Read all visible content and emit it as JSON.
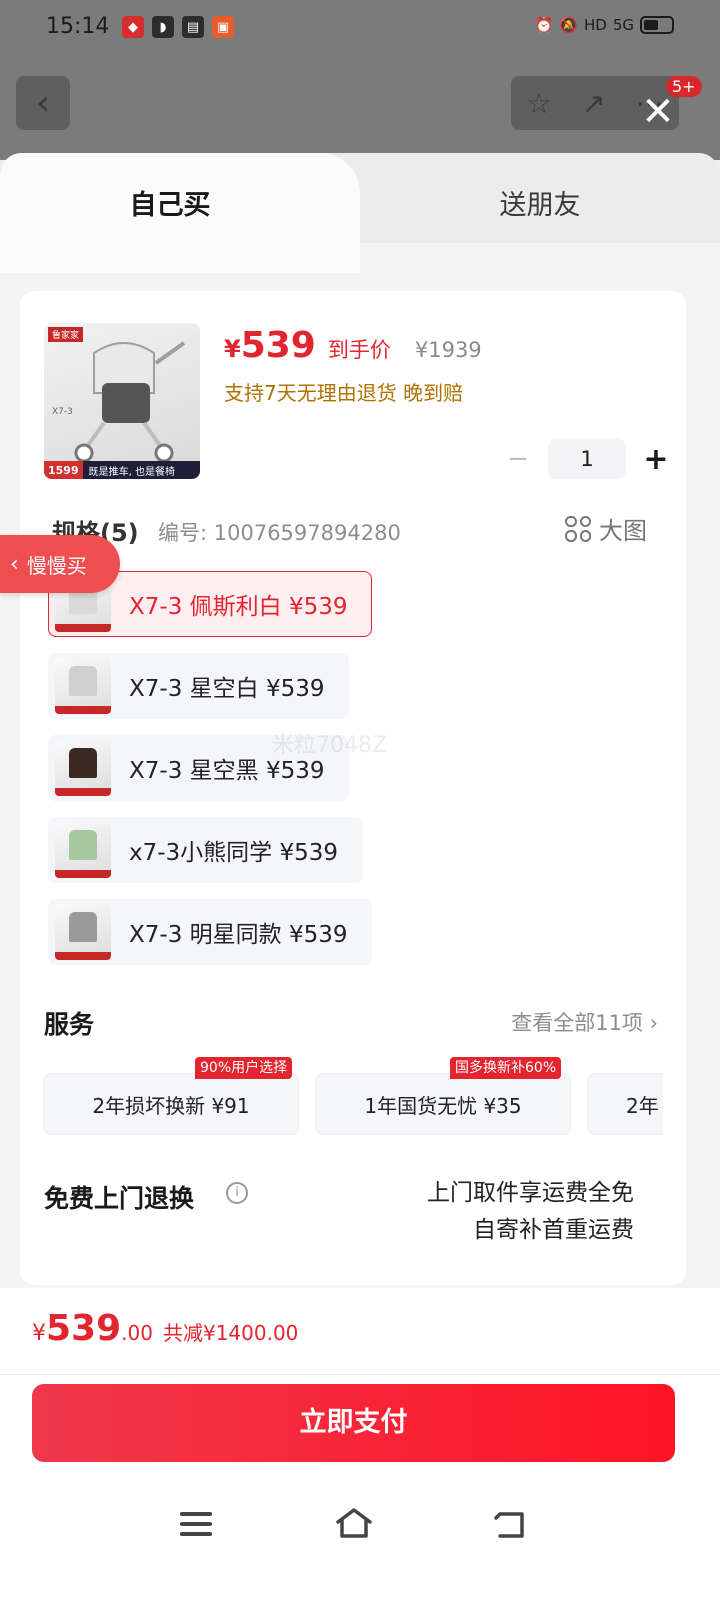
{
  "status_bar": {
    "time": "15:14",
    "signal": "5G",
    "hd": "HD"
  },
  "background": {
    "badge": "5+"
  },
  "tabs": {
    "self": "自己买",
    "friend": "送朋友"
  },
  "product": {
    "image_tag": "鲁家家",
    "image_model": "X7-3",
    "image_price": "1599",
    "image_slogan": "既是推车, 也是餐椅",
    "price_currency": "¥",
    "price": "539",
    "price_tag": "到手价",
    "original_price": "¥1939",
    "promise": "支持7天无理由退货  晚到赔",
    "quantity": "1",
    "minus": "−",
    "plus": "+"
  },
  "spec": {
    "title": "规格(5)",
    "code": "编号: 10076597894280",
    "big_image": "大图",
    "watermark": "米粒7048Z",
    "variants": [
      {
        "label": "X7-3 佩斯利白  ¥539",
        "selected": true,
        "color": "#d9d9d9"
      },
      {
        "label": "X7-3 星空白  ¥539",
        "selected": false,
        "color": "#cfcfcf"
      },
      {
        "label": "X7-3 星空黑  ¥539",
        "selected": false,
        "color": "#3a2a22"
      },
      {
        "label": "x7-3小熊同学  ¥539",
        "selected": false,
        "color": "#a7c7a0"
      },
      {
        "label": "X7-3 明星同款  ¥539",
        "selected": false,
        "color": "#9a9a9a"
      }
    ]
  },
  "service": {
    "title": "服务",
    "more": "查看全部11项 ›",
    "items": [
      {
        "label": "2年损坏换新 ¥91",
        "badge": "90%用户选择"
      },
      {
        "label": "1年国货无忧 ¥35",
        "badge": "国多换新补60%"
      },
      {
        "label": "2年",
        "badge": ""
      }
    ]
  },
  "free_return": {
    "title": "免费上门退换",
    "info": "i",
    "line1": "上门取件享运费全免",
    "line2": "自寄补首重运费"
  },
  "slow_buy": {
    "label": "慢慢买"
  },
  "footer": {
    "yen": "¥",
    "total_int": "539",
    "total_dec": ".00",
    "discount": "共减¥1400.00",
    "pay_button": "立即支付"
  },
  "colors": {
    "accent": "#e3252f",
    "promise": "#b07300"
  }
}
